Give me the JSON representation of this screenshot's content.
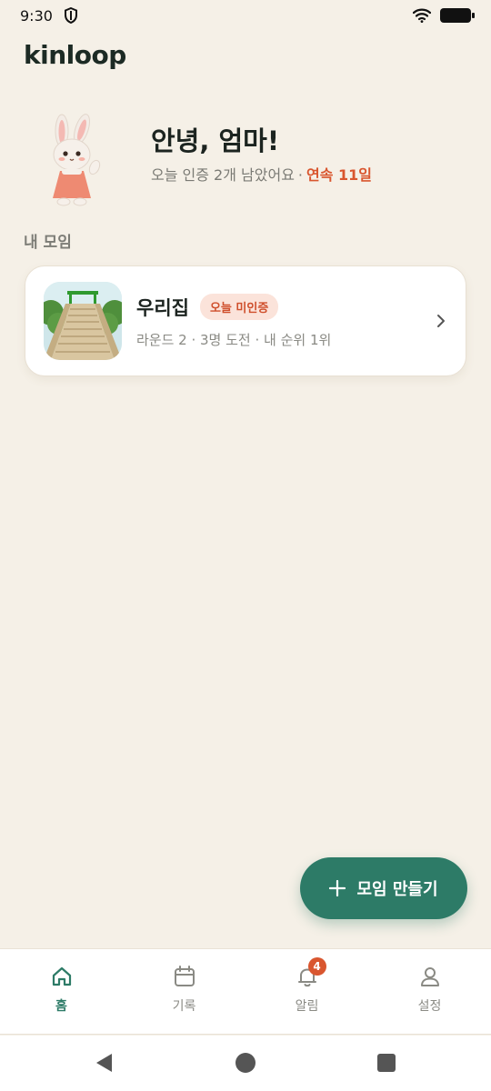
{
  "status_bar": {
    "time": "9:30",
    "icons": [
      "shield-icon",
      "wifi-icon",
      "battery-icon"
    ]
  },
  "app": {
    "logo": "kinloop"
  },
  "greeting": {
    "title": "안녕, 엄마!",
    "subtitle": "오늘 인증 2개 남았어요",
    "separator": "·",
    "streak": "연속 11일",
    "mascot": "bunny-mascot"
  },
  "groups_section": {
    "title": "내 모임",
    "groups": [
      {
        "name": "우리집",
        "badge": "오늘 미인증",
        "meta": "라운드 2 · 3명 도전 · 내 순위 1위",
        "thumbnail": "stairs-image"
      }
    ]
  },
  "fab": {
    "icon": "plus",
    "label": "모임 만들기"
  },
  "bottom_nav": {
    "items": [
      {
        "label": "홈",
        "icon": "home-icon",
        "active": true
      },
      {
        "label": "기록",
        "icon": "calendar-icon",
        "active": false
      },
      {
        "label": "알림",
        "icon": "bell-icon",
        "active": false,
        "badge": "4"
      },
      {
        "label": "설정",
        "icon": "person-icon",
        "active": false
      }
    ]
  },
  "colors": {
    "background": "#f5f0e7",
    "accent": "#2d7b67",
    "alert": "#d9562f",
    "badge_bg": "#fbe3da"
  }
}
